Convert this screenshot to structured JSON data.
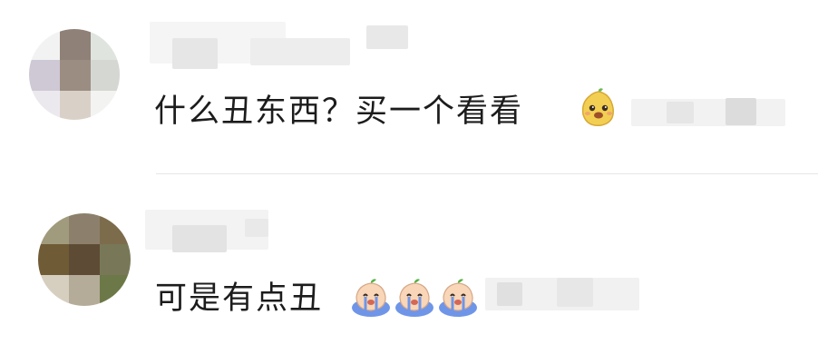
{
  "comments": [
    {
      "text": "什么丑东西？买一个看看",
      "emojis": [
        "mango-face-icon"
      ]
    },
    {
      "text": "可是有点丑",
      "emojis": [
        "crying-face-icon",
        "crying-face-icon",
        "crying-face-icon"
      ]
    }
  ],
  "colors": {
    "text": "#1c1c1c",
    "divider": "#e6e6e6",
    "emoji_yellow": "#f2cf52",
    "emoji_blue": "#6f95e8"
  }
}
